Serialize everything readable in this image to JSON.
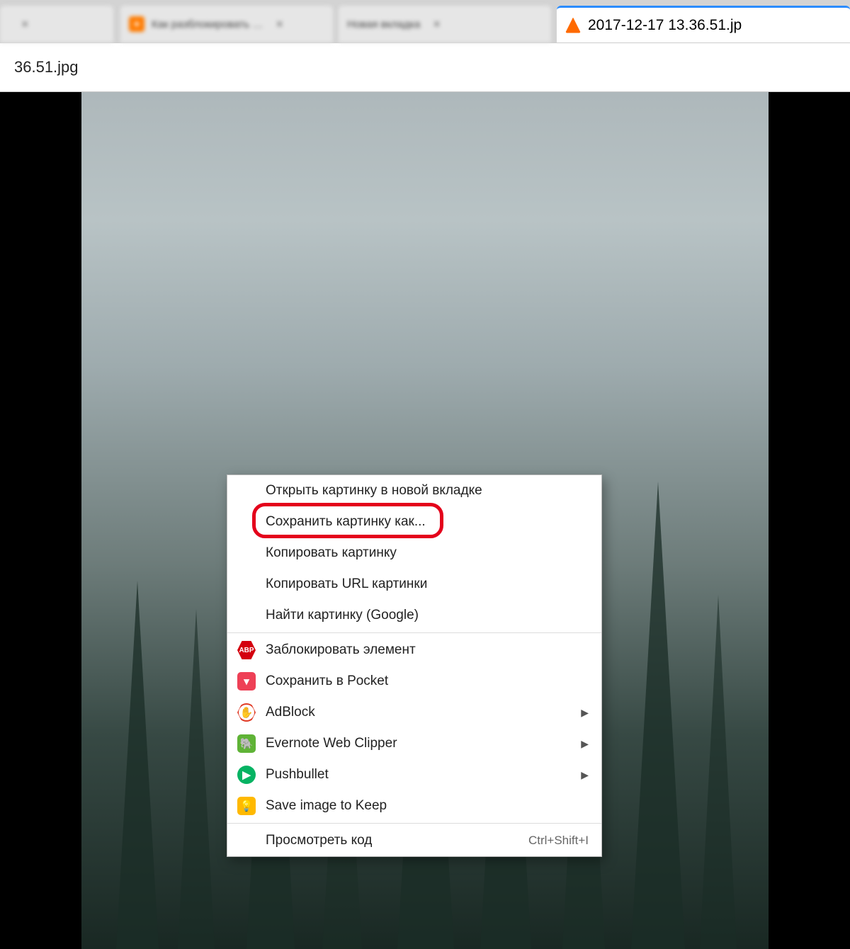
{
  "tabs": [
    {
      "label": ""
    },
    {
      "label": "Как разблокировать …"
    },
    {
      "label": "Новая вкладка"
    },
    {
      "label": "2017-12-17 13.36.51.jp"
    }
  ],
  "addressbar": {
    "value": "36.51.jpg"
  },
  "context_menu": {
    "open_new_tab": "Открыть картинку в новой вкладке",
    "save_as": "Сохранить картинку как...",
    "copy_image": "Копировать картинку",
    "copy_url": "Копировать URL картинки",
    "find_google": "Найти картинку (Google)",
    "abp_block": "Заблокировать элемент",
    "pocket": "Сохранить в Pocket",
    "adblock": "AdBlock",
    "evernote": "Evernote Web Clipper",
    "pushbullet": "Pushbullet",
    "keep": "Save image to Keep",
    "inspect": "Просмотреть код",
    "inspect_shortcut": "Ctrl+Shift+I"
  }
}
